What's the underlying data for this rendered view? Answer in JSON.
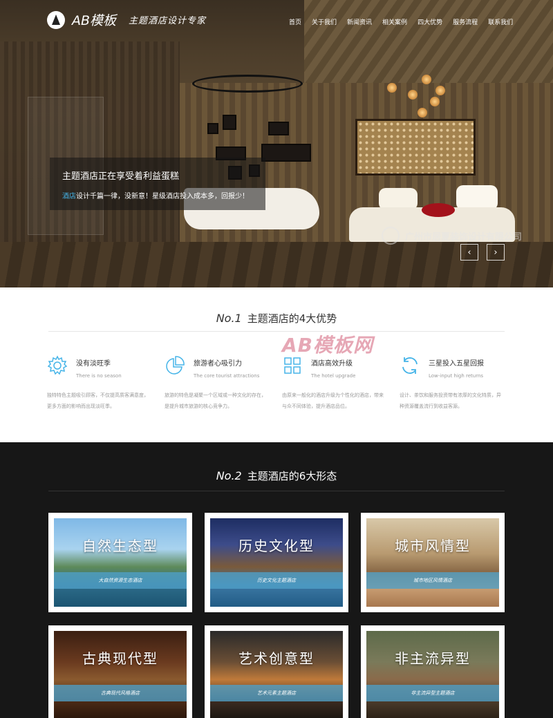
{
  "brand": {
    "logo_text": "AB模板",
    "tagline": "主题酒店设计专家"
  },
  "nav": [
    "首页",
    "关于我们",
    "新闻资讯",
    "相关案例",
    "四大优势",
    "服务流程",
    "联系我们"
  ],
  "hero": {
    "caption_title": "主题酒店正在享受着利益蛋糕",
    "caption_text_highlight": "酒店",
    "caption_text": "设计千篇一律，没新意！星级酒店投入成本多，回报少！",
    "watermark": "广州市居夏装饰设计有限公司",
    "prev_arrow": "‹",
    "next_arrow": "›"
  },
  "section1": {
    "number": "No.1",
    "title": "主题酒店的4大优势",
    "watermark": "AB模板网",
    "advantages": [
      {
        "title": "没有淡旺季",
        "en": "There is no season",
        "desc": "独特特色主题吸引顾客，不仅提高质客满意度，更多方面的影响而出现淡旺季。",
        "icon": "gear-icon"
      },
      {
        "title": "旅游者心吸引力",
        "en": "The core tourist attractions",
        "desc": "旅游的特色是凝聚一个区域或一种文化的存在，是提升城市旅游的核心竞争力。",
        "icon": "pie-chart-icon"
      },
      {
        "title": "酒店高效升级",
        "en": "The hotel upgrade",
        "desc": "由原来一般化的酒店升级为个性化的酒店，带来与众不同体验，提升酒店品位。",
        "icon": "blocks-icon"
      },
      {
        "title": "三星投入五星回报",
        "en": "Low-input high returns",
        "desc": "设计、茶饮和服务投资带有浓厚的文化特质，异种资源覆盖流行到收益客源。",
        "icon": "refresh-icon"
      }
    ]
  },
  "section2": {
    "number": "No.2",
    "title": "主题酒店的6大形态",
    "cards": [
      {
        "title": "自然生态型",
        "sub": "大自然资源生态酒店"
      },
      {
        "title": "历史文化型",
        "sub": "历史文化主题酒店"
      },
      {
        "title": "城市风情型",
        "sub": "城市地区风情酒店"
      },
      {
        "title": "古典现代型",
        "sub": "古典现代风格酒店"
      },
      {
        "title": "艺术创意型",
        "sub": "艺术元素主题酒店"
      },
      {
        "title": "非主流异型",
        "sub": "非主流异型主题酒店"
      }
    ]
  },
  "colors": {
    "accent_blue": "#45b4e8",
    "band_blue": "#50a0c8",
    "dark_bg": "#171717"
  }
}
